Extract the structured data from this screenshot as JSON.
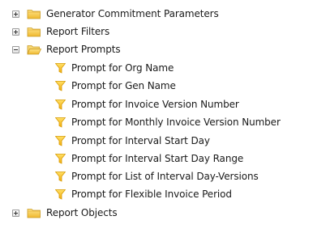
{
  "tree": {
    "generator_commitment_parameters": "Generator Commitment Parameters",
    "report_filters": "Report Filters",
    "report_prompts": {
      "label": "Report Prompts",
      "children": [
        "Prompt for Org Name",
        "Prompt for Gen Name",
        "Prompt for Invoice Version Number",
        "Prompt for Monthly Invoice Version Number",
        "Prompt for Interval Start Day",
        "Prompt for Interval Start Day Range",
        "Prompt for List of Interval Day-Versions",
        "Prompt for Flexible Invoice Period"
      ]
    },
    "report_objects": "Report Objects"
  },
  "colors": {
    "folder_yellow": "#f5c94a",
    "funnel_yellow": "#f8c21c",
    "text": "#1a1a1a"
  }
}
